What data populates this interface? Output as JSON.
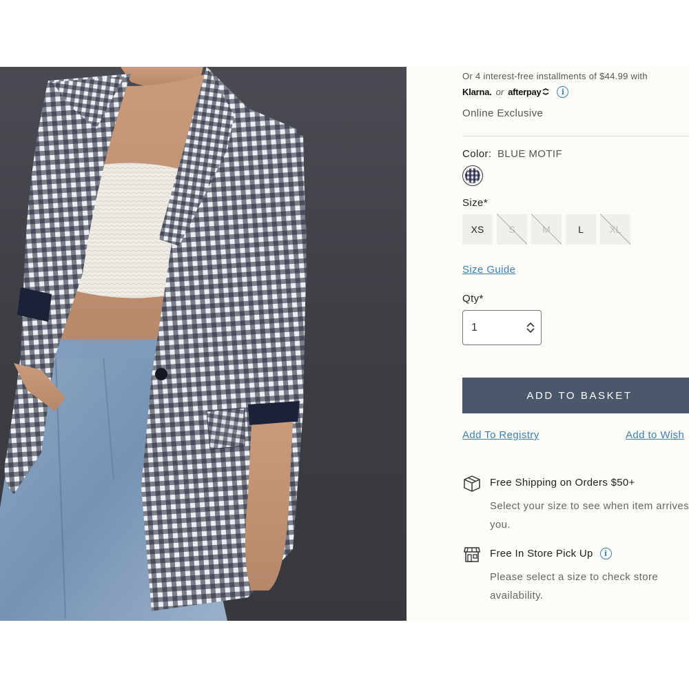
{
  "product_image": {
    "alt": "Gingham blazer product photo",
    "pattern_colors": [
      "#1f2335",
      "#eceff2"
    ],
    "background": "#3f4046"
  },
  "pricing": {
    "installments_text": "Or 4 interest-free installments of $44.99 with",
    "klarna_label": "Klarna.",
    "or_label": "or",
    "afterpay_label": "afterpay"
  },
  "availability_note": "Online Exclusive",
  "color": {
    "label": "Color:",
    "value": "BLUE MOTIF"
  },
  "size": {
    "label": "Size*",
    "options": [
      {
        "label": "XS",
        "available": true
      },
      {
        "label": "S",
        "available": false
      },
      {
        "label": "M",
        "available": false
      },
      {
        "label": "L",
        "available": true
      },
      {
        "label": "XL",
        "available": false
      }
    ],
    "guide_link": "Size Guide"
  },
  "quantity": {
    "label": "Qty*",
    "value": "1"
  },
  "actions": {
    "add_to_basket": "ADD TO BASKET",
    "add_to_registry": "Add To Registry",
    "add_to_wishlist": "Add to Wish"
  },
  "shipping": {
    "title": "Free Shipping on Orders $50+",
    "description": "Select your size to see when item arrives you."
  },
  "pickup": {
    "title": "Free In Store Pick Up",
    "description": "Please select a size to check store availability."
  },
  "colors": {
    "link": "#3f7fb2",
    "button": "#4a586a",
    "panel_bg": "#fbfbf8"
  }
}
